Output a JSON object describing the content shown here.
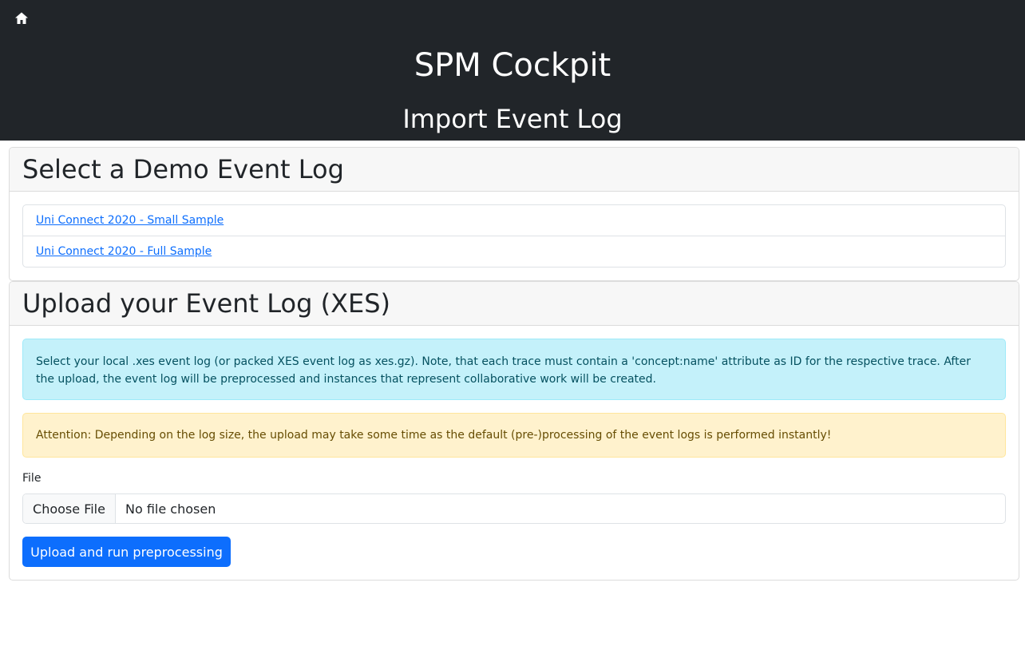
{
  "header": {
    "home_icon": "home-icon",
    "app_title": "SPM Cockpit",
    "page_title": "Import Event Log"
  },
  "demo_card": {
    "title": "Select a Demo Event Log",
    "links": [
      "Uni Connect 2020 - Small Sample",
      "Uni Connect 2020 - Full Sample"
    ]
  },
  "upload_card": {
    "title": "Upload your Event Log (XES)",
    "info_text": "Select your local .xes event log (or packed XES event log as xes.gz). Note, that each trace must contain a 'concept:name' attribute as ID for the respective trace. After the upload, the event log will be preprocessed and instances that represent collaborative work will be created.",
    "warning_text": "Attention: Depending on the log size, the upload may take some time as the default (pre-)processing of the event logs is performed instantly!",
    "file_label": "File",
    "choose_file_label": "Choose File",
    "file_status": "No file chosen",
    "submit_label": "Upload and run preprocessing"
  },
  "colors": {
    "header_bg": "#212529",
    "link": "#0d6efd",
    "primary": "#0d6efd",
    "info_bg": "#c4f1fa",
    "warning_bg": "#fff2cd"
  }
}
